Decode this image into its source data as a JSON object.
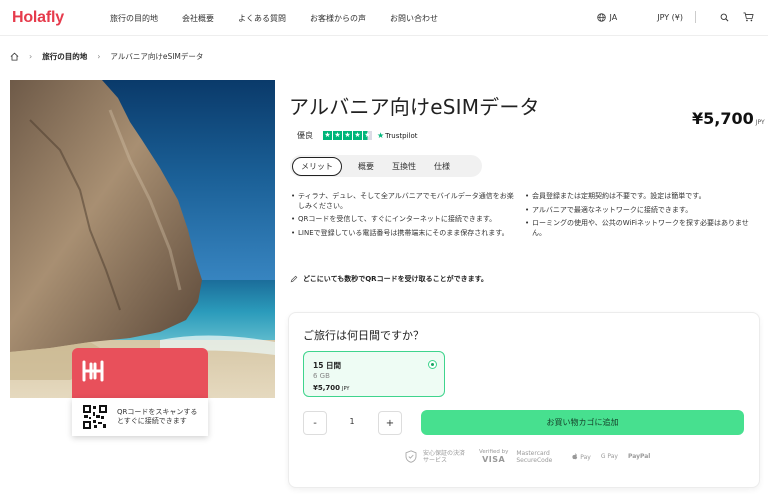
{
  "header": {
    "logo": "Holafly",
    "nav": [
      "旅行の目的地",
      "会社概要",
      "よくある質問",
      "お客様からの声",
      "お問い合わせ"
    ],
    "language": "JA",
    "currency": "JPY (¥)"
  },
  "breadcrumb": {
    "items": [
      "旅行の目的地",
      "アルバニア向けeSIMデータ"
    ]
  },
  "product": {
    "title": "アルバニア向けeSIMデータ",
    "price": "¥5,700",
    "price_currency": "JPY",
    "rating_label": "優良",
    "rating_stars": 4.5,
    "trustpilot": "Trustpilot"
  },
  "tabs": [
    "メリット",
    "概要",
    "互換性",
    "仕様"
  ],
  "benefits_left": [
    "ティラナ、デュレ、そして全アルバニアでモバイルデータ通信をお楽しみください。",
    "QRコードを受信して、すぐにインターネットに接続できます。",
    "LINEで登録している電話番号は携帯端末にそのまま保存されます。"
  ],
  "benefits_right": [
    "会員登録または定期契約は不要です。設定は簡単です。",
    "アルバニアで最適なネットワークに接続できます。",
    "ローミングの使用や、公共のWiFiネットワークを探す必要はありません。"
  ],
  "qr_note": "どこにいても数秒でQRコードを受け取ることができます。",
  "hero_card": {
    "qr_text": "QRコードをスキャンするとすぐに接続できます"
  },
  "purchase": {
    "question": "ご旅行は何日間ですか？",
    "plan_days": "15 日間",
    "plan_data": "6 GB",
    "plan_price": "¥5,700",
    "plan_currency": "JPY",
    "qty_minus": "-",
    "qty_value": "1",
    "qty_plus": "+",
    "cart_label": "お買い物カゴに追加"
  },
  "payments": {
    "secure_text": "安心保証の決済サービス",
    "visa_top": "Verified by",
    "visa": "VISA",
    "mastercard": "Mastercard SecureCode",
    "apple_pay": "Pay",
    "google_pay": "G Pay",
    "paypal": "PayPal"
  },
  "colors": {
    "brand": "#e63b4c",
    "accent_green": "#47e08f",
    "trustpilot_green": "#00b67a"
  }
}
